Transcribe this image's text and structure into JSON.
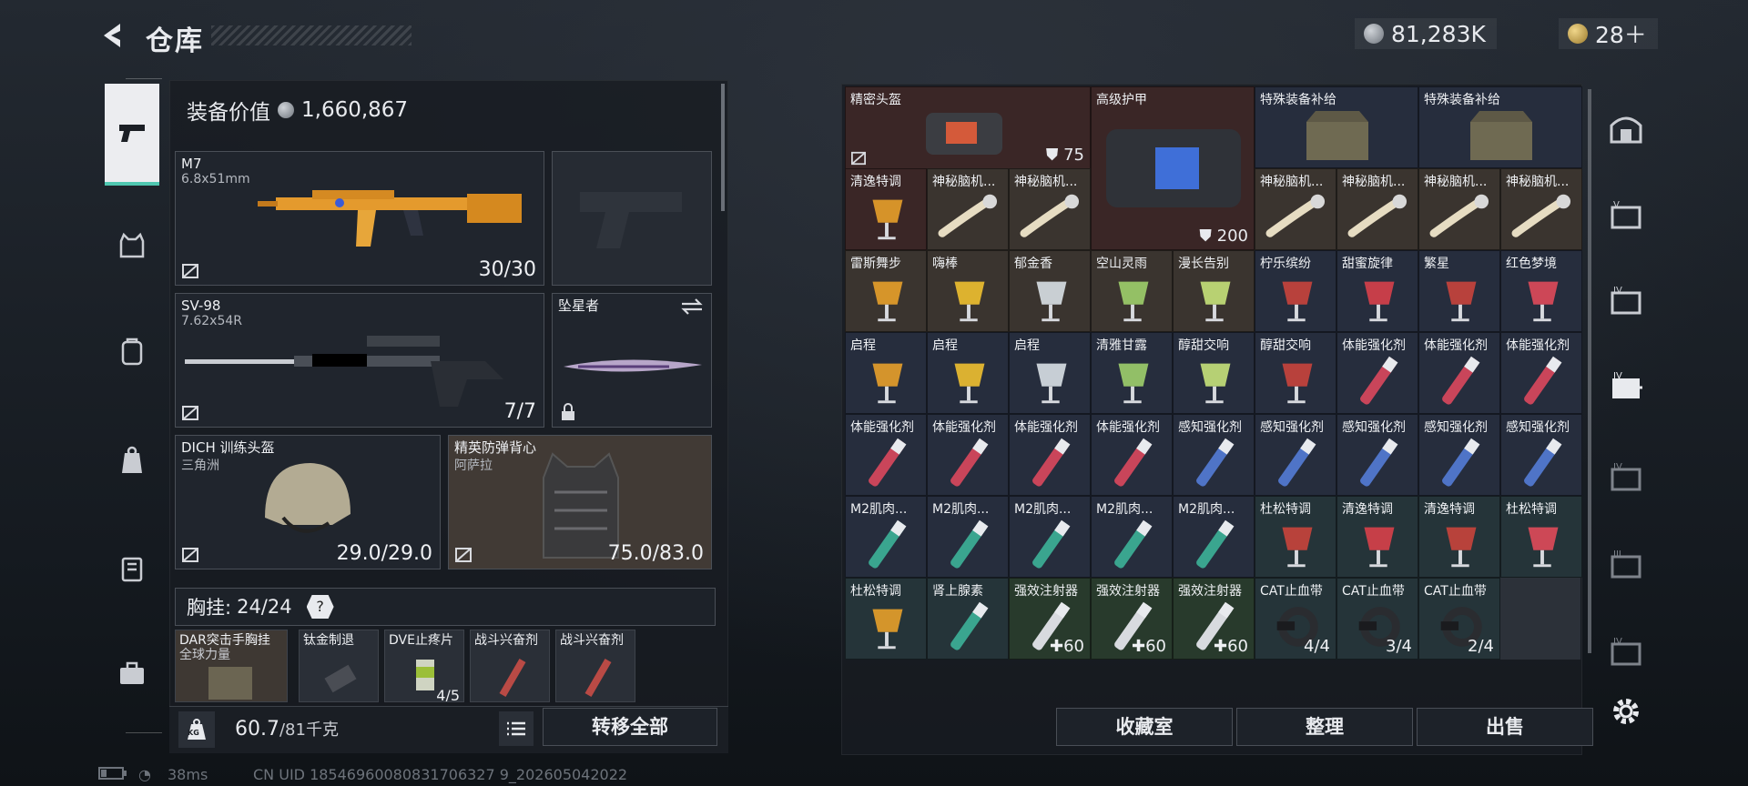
{
  "header": {
    "title": "仓库",
    "currency1": "81,283K",
    "currency2": "28＋"
  },
  "left": {
    "equip_label": "装备价值",
    "equip_value": "1,660,867",
    "primary": {
      "name": "M7",
      "ammo": "6.8x51mm",
      "count": "30/30"
    },
    "secondary": {
      "name": "SV-98",
      "ammo": "7.62x54R",
      "count": "7/7"
    },
    "melee": {
      "name": "坠星者"
    },
    "helmet": {
      "name": "DICH 训练头盔",
      "sub": "三角洲",
      "dur": "29.0/29.0"
    },
    "armor": {
      "name": "精英防弹背心",
      "sub": "阿萨拉",
      "dur": "75.0/83.0"
    },
    "chest": {
      "label": "胸挂:",
      "count": "24/24",
      "help": "?"
    },
    "chest_items": [
      "DAR突击手胸挂",
      "钛金制退",
      "DVE止疼片",
      "战斗兴奋剂",
      "战斗兴奋剂"
    ],
    "chest_sub": "全球力量",
    "chest_stack": "4/5",
    "weight": {
      "value": "60.7",
      "max": "/81千克",
      "kg": "KG"
    },
    "transfer_btn": "转移全部"
  },
  "grid": {
    "big": [
      {
        "name": "精密头盔",
        "count": "75"
      },
      {
        "name": "高级护甲",
        "count": "200"
      },
      {
        "name": "特殊装备补给"
      },
      {
        "name": "特殊装备补给"
      }
    ],
    "r1": [
      "清逸特调",
      "神秘脑机...",
      "神秘脑机...",
      "神秘脑机...",
      "神秘脑机...",
      "神秘脑机...",
      "神秘脑机..."
    ],
    "r2": [
      "雷斯舞步",
      "嗨棒",
      "郁金香",
      "空山灵雨",
      "漫长告别",
      "柠乐缤纷",
      "甜蜜旋律",
      "繁星",
      "红色梦境"
    ],
    "r3": [
      "启程",
      "启程",
      "启程",
      "清雅甘露",
      "醇甜交响",
      "醇甜交响",
      "体能强化剂",
      "体能强化剂",
      "体能强化剂"
    ],
    "r4": [
      "体能强化剂",
      "体能强化剂",
      "体能强化剂",
      "体能强化剂",
      "感知强化剂",
      "感知强化剂",
      "感知强化剂",
      "感知强化剂",
      "感知强化剂"
    ],
    "r5": [
      "M2肌肉...",
      "M2肌肉...",
      "M2肌肉...",
      "M2肌肉...",
      "M2肌肉...",
      "杜松特调",
      "清逸特调",
      "清逸特调",
      "杜松特调"
    ],
    "r6": [
      "杜松特调",
      "肾上腺素",
      "强效注射器",
      "强效注射器",
      "强效注射器",
      "CAT止血带",
      "CAT止血带",
      "CAT止血带"
    ],
    "r6_counts": [
      "",
      "",
      "✚60",
      "✚60",
      "✚60",
      "4/4",
      "3/4",
      "2/4"
    ]
  },
  "buttons": {
    "collection": "收藏室",
    "sort": "整理",
    "sell": "出售"
  },
  "footer": {
    "ping": "38ms",
    "uid": "CN UID 18546960080831706327 9_202605042022"
  }
}
